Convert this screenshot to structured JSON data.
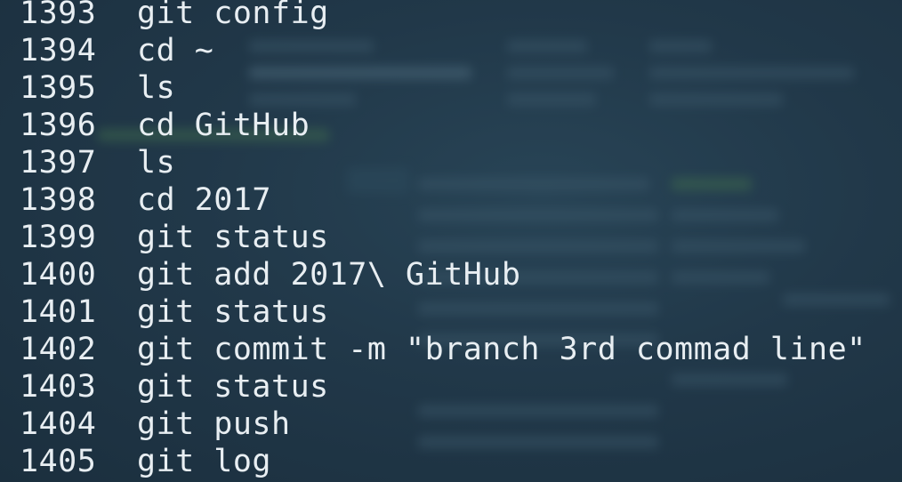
{
  "history": [
    {
      "num": "1393",
      "cmd": "git config"
    },
    {
      "num": "1394",
      "cmd": "cd ~"
    },
    {
      "num": "1395",
      "cmd": "ls"
    },
    {
      "num": "1396",
      "cmd": "cd GitHub"
    },
    {
      "num": "1397",
      "cmd": "ls"
    },
    {
      "num": "1398",
      "cmd": "cd 2017"
    },
    {
      "num": "1399",
      "cmd": "git status"
    },
    {
      "num": "1400",
      "cmd": "git add 2017\\ GitHub"
    },
    {
      "num": "1401",
      "cmd": "git status"
    },
    {
      "num": "1402",
      "cmd": "git commit -m \"branch 3rd commad line\""
    },
    {
      "num": "1403",
      "cmd": "git status"
    },
    {
      "num": "1404",
      "cmd": "git push"
    },
    {
      "num": "1405",
      "cmd": "git log"
    }
  ],
  "colors": {
    "background": "#213849",
    "text": "#e8eef2"
  }
}
